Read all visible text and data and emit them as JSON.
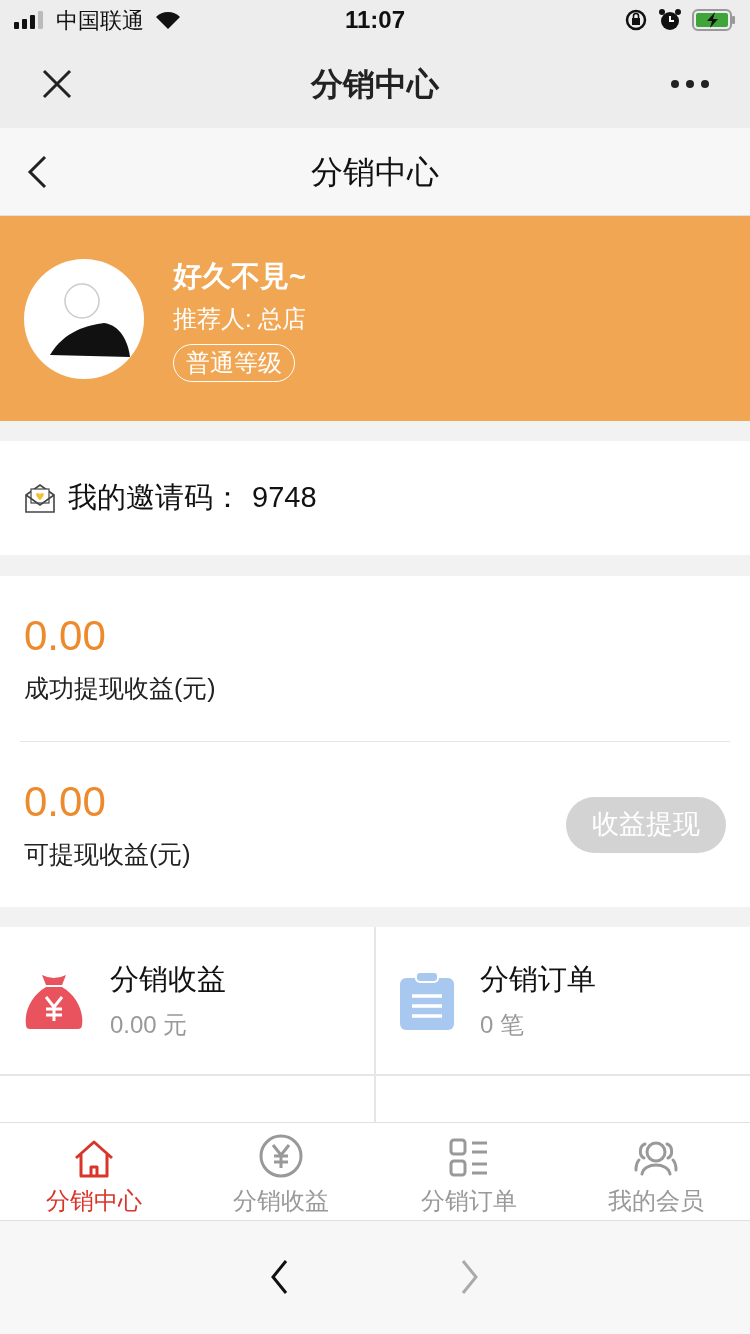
{
  "status_bar": {
    "carrier": "中国联通",
    "time": "11:07"
  },
  "wechat_bar": {
    "title": "分销中心"
  },
  "header": {
    "title": "分销中心"
  },
  "profile": {
    "name": "好久不見~",
    "referrer": "推荐人: 总店",
    "level_badge": "普通等级"
  },
  "invite": {
    "label": "我的邀请码：",
    "code": "9748"
  },
  "earnings": [
    {
      "amount": "0.00",
      "label": "成功提现收益(元)"
    },
    {
      "amount": "0.00",
      "label": "可提现收益(元)",
      "button": {
        "label": "收益提现",
        "disabled": true
      }
    }
  ],
  "grid": [
    {
      "kind": "moneybag",
      "title": "分销收益",
      "value": "0.00 元"
    },
    {
      "kind": "clipboard",
      "title": "分销订单",
      "value": "0 笔"
    }
  ],
  "tabs": [
    {
      "kind": "home",
      "label": "分销中心",
      "selected": true
    },
    {
      "kind": "yen",
      "label": "分销收益",
      "selected": false
    },
    {
      "kind": "list",
      "label": "分销订单",
      "selected": false
    },
    {
      "kind": "people",
      "label": "我的会员",
      "selected": false
    }
  ],
  "browser_bar": {
    "back": {
      "disabled": false
    },
    "forward": {
      "disabled": true
    }
  }
}
